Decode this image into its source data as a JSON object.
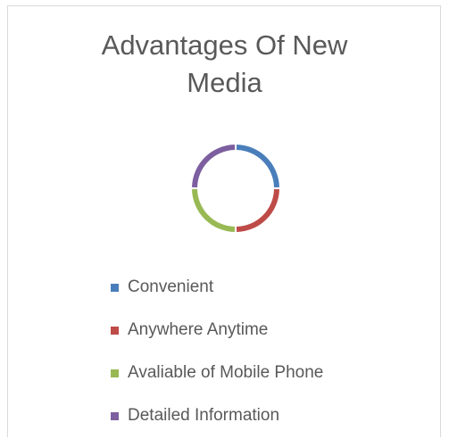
{
  "chart_data": {
    "type": "pie",
    "title": "Advantages Of New\nMedia",
    "categories": [
      "Convenient",
      "Anywhere Anytime",
      "Avaliable of Mobile Phone",
      "Detailed Information"
    ],
    "values": [
      1,
      1,
      1,
      1
    ],
    "colors": [
      "#4a7ebb",
      "#be4b48",
      "#98b954",
      "#7d5fa0"
    ],
    "donut": true,
    "legend_position": "bottom",
    "data_labels": false
  }
}
